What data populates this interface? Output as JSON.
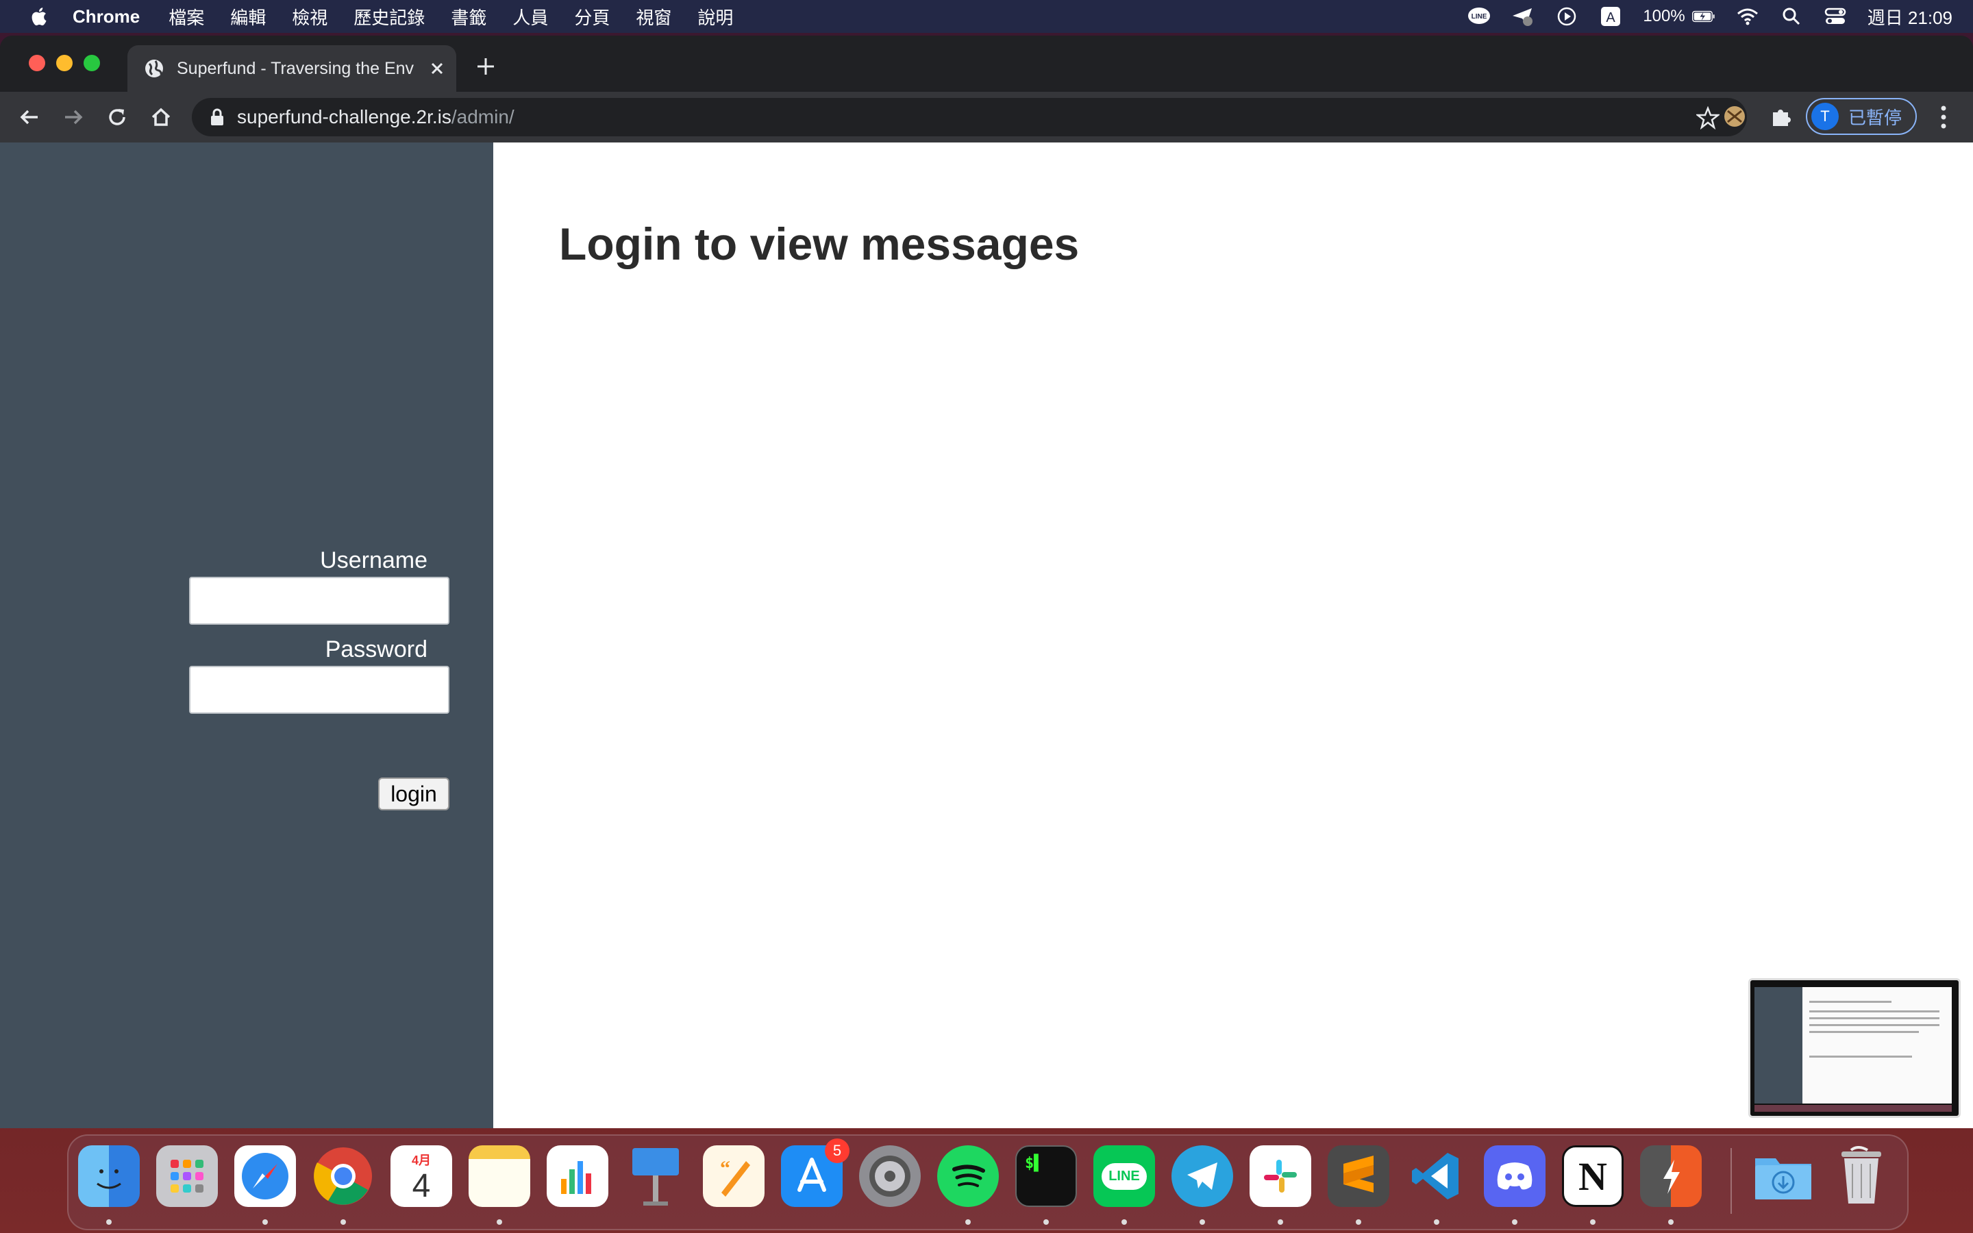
{
  "menubar": {
    "app_name": "Chrome",
    "items": [
      "檔案",
      "編輯",
      "檢視",
      "歷史記錄",
      "書籤",
      "人員",
      "分頁",
      "視窗",
      "說明"
    ],
    "battery": "100%",
    "clock": "週日 21:09",
    "status_icons": [
      "line-icon",
      "send-icon",
      "play-icon",
      "input-method-icon",
      "battery-icon",
      "wifi-icon",
      "spotlight-icon",
      "control-center-icon"
    ]
  },
  "browser": {
    "tab_title": "Superfund - Traversing the Env",
    "url_host": "superfund-challenge.2r.is",
    "url_path": "/admin/",
    "profile_initial": "T",
    "profile_status": "已暫停"
  },
  "page": {
    "title": "Login to view messages",
    "username_label": "Username",
    "password_label": "Password",
    "login_button": "login"
  },
  "dock": {
    "apps": [
      "Finder",
      "Launchpad",
      "Safari",
      "Chrome",
      "Calendar",
      "Notes",
      "Numbers",
      "Keynote",
      "Pages",
      "App Store",
      "System Preferences",
      "Spotify",
      "Terminal",
      "LINE",
      "Telegram",
      "Slack",
      "Sublime Text",
      "VS Code",
      "Discord",
      "Notion",
      "Postman",
      "Downloads",
      "Trash"
    ],
    "calendar_month": "4月",
    "calendar_day": "4",
    "app_store_badge": "5",
    "line_label": "LINE"
  },
  "colors": {
    "sidebar": "#424f5b",
    "menubar": "#232846",
    "browser_chrome": "#35363a"
  }
}
